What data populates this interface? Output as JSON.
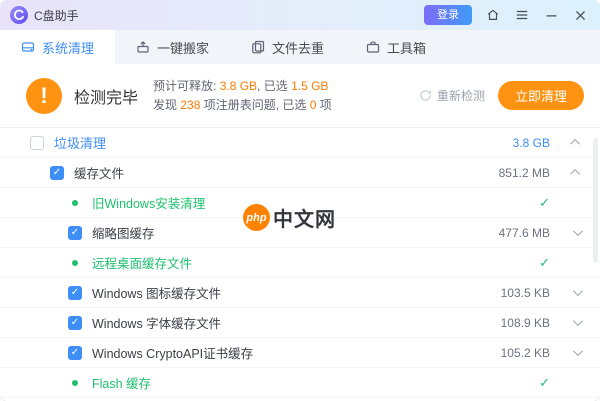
{
  "colors": {
    "accent_blue": "#3e8ef7",
    "accent_orange": "#ff9211",
    "orange_text": "#ff7a00",
    "accent_green": "#1ec06e",
    "titlebar_gradient": [
      "#e9e3f9",
      "#dcf1fc"
    ]
  },
  "titlebar": {
    "app_name": "C盘助手",
    "login_label": "登录"
  },
  "tabs": [
    {
      "label": "系统清理",
      "active": true
    },
    {
      "label": "一键搬家",
      "active": false
    },
    {
      "label": "文件去重",
      "active": false
    },
    {
      "label": "工具箱",
      "active": false
    }
  ],
  "summary": {
    "status": "检测完毕",
    "line1": {
      "prefix": "预计可释放: ",
      "value1": "3.8 GB",
      "mid": ", 已选 ",
      "value2": "1.5 GB"
    },
    "line2": {
      "prefix": "发现 ",
      "value1": "238",
      "mid": " 项注册表问题, 已选 ",
      "value2": "0",
      "suffix": " 项"
    },
    "recheck_label": "重新检测",
    "clean_label": "立即清理"
  },
  "rows": [
    {
      "type": "group",
      "label": "垃圾清理",
      "size": "3.8 GB",
      "checked": false,
      "chevron": "up"
    },
    {
      "type": "parent",
      "label": "缓存文件",
      "size": "851.2 MB",
      "checked": true,
      "chevron": "up"
    },
    {
      "type": "done",
      "label": "旧Windows安装清理"
    },
    {
      "type": "item",
      "label": "缩略图缓存",
      "size": "477.6 MB",
      "checked": true,
      "chevron": "down"
    },
    {
      "type": "done",
      "label": "远程桌面缓存文件"
    },
    {
      "type": "item",
      "label": "Windows 图标缓存文件",
      "size": "103.5 KB",
      "checked": true,
      "chevron": "down"
    },
    {
      "type": "item",
      "label": "Windows 字体缓存文件",
      "size": "108.9 KB",
      "checked": true,
      "chevron": "down"
    },
    {
      "type": "item",
      "label": "Windows CryptoAPI证书缓存",
      "size": "105.2 KB",
      "checked": true,
      "chevron": "down"
    },
    {
      "type": "done",
      "label": "Flash 缓存"
    }
  ],
  "watermark": {
    "badge": "php",
    "text": "中文网"
  }
}
